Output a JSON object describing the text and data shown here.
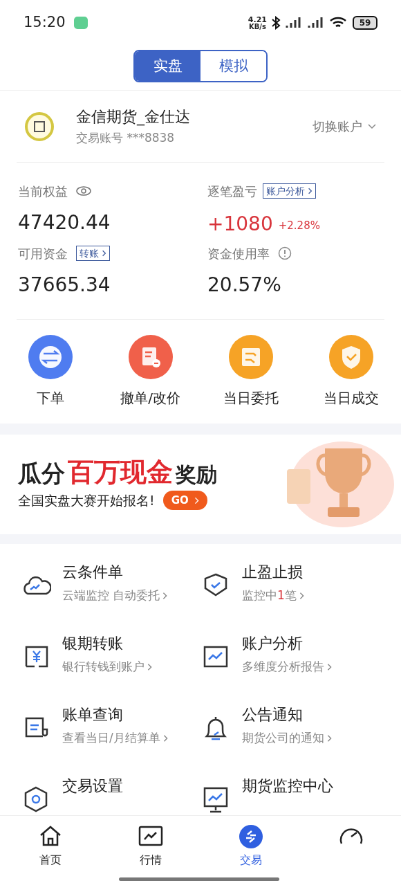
{
  "status_bar": {
    "time": "15:20",
    "speed_value": "4.21",
    "speed_unit": "KB/s",
    "battery": "59"
  },
  "mode_tabs": [
    {
      "label": "实盘",
      "selected": true
    },
    {
      "label": "模拟",
      "selected": false
    }
  ],
  "account": {
    "name": "金信期货_金仕达",
    "number": "交易账号 ***8838",
    "switch_label": "切换账户"
  },
  "stats": {
    "equity_label": "当前权益",
    "equity_value": "47420.44",
    "pnl_label": "逐笔盈亏",
    "pnl_link": "账户分析",
    "pnl_value": "+1080",
    "pnl_percent": "+2.28%",
    "available_label": "可用资金",
    "available_link": "转账",
    "available_value": "37665.34",
    "usage_label": "资金使用率",
    "usage_value": "20.57%"
  },
  "quick_actions": [
    {
      "label": "下单",
      "kind": "order",
      "color": "#4f7cf0"
    },
    {
      "label": "撤单/改价",
      "kind": "cancel",
      "color": "#f0604a"
    },
    {
      "label": "当日委托",
      "kind": "entrust",
      "color": "#f6a326"
    },
    {
      "label": "当日成交",
      "kind": "deal",
      "color": "#f6a326"
    }
  ],
  "banner": {
    "title_start": "瓜分",
    "title_highlight": "百万现金",
    "title_end": "奖励",
    "subtitle": "全国实盘大赛开始报名!",
    "button": "GO"
  },
  "menu": [
    {
      "kind": "cloud",
      "title": "云条件单",
      "subtitle": [
        {
          "text": "云端监控 自动委托",
          "highlight": false
        }
      ]
    },
    {
      "kind": "shield",
      "title": "止盈止损",
      "subtitle": [
        {
          "text": "监控中",
          "highlight": false
        },
        {
          "text": "1",
          "highlight": true
        },
        {
          "text": "笔",
          "highlight": false
        }
      ]
    },
    {
      "kind": "yuan",
      "title": "银期转账",
      "subtitle": [
        {
          "text": "银行转钱到账户",
          "highlight": false
        }
      ]
    },
    {
      "kind": "chart",
      "title": "账户分析",
      "subtitle": [
        {
          "text": "多维度分析报告",
          "highlight": false
        }
      ]
    },
    {
      "kind": "bill",
      "title": "账单查询",
      "subtitle": [
        {
          "text": "查看当日/月结算单",
          "highlight": false
        }
      ]
    },
    {
      "kind": "bell",
      "title": "公告通知",
      "subtitle": [
        {
          "text": "期货公司的通知",
          "highlight": false
        }
      ]
    },
    {
      "kind": "hexagon",
      "title": "交易设置"
    },
    {
      "kind": "monitor",
      "title": "期货监控中心"
    }
  ],
  "nav": [
    {
      "kind": "home",
      "label": "首页",
      "selected": false
    },
    {
      "kind": "market",
      "label": "行情",
      "selected": false
    },
    {
      "kind": "trade",
      "label": "交易",
      "selected": true
    },
    {
      "kind": "gauge",
      "selected": false
    }
  ]
}
